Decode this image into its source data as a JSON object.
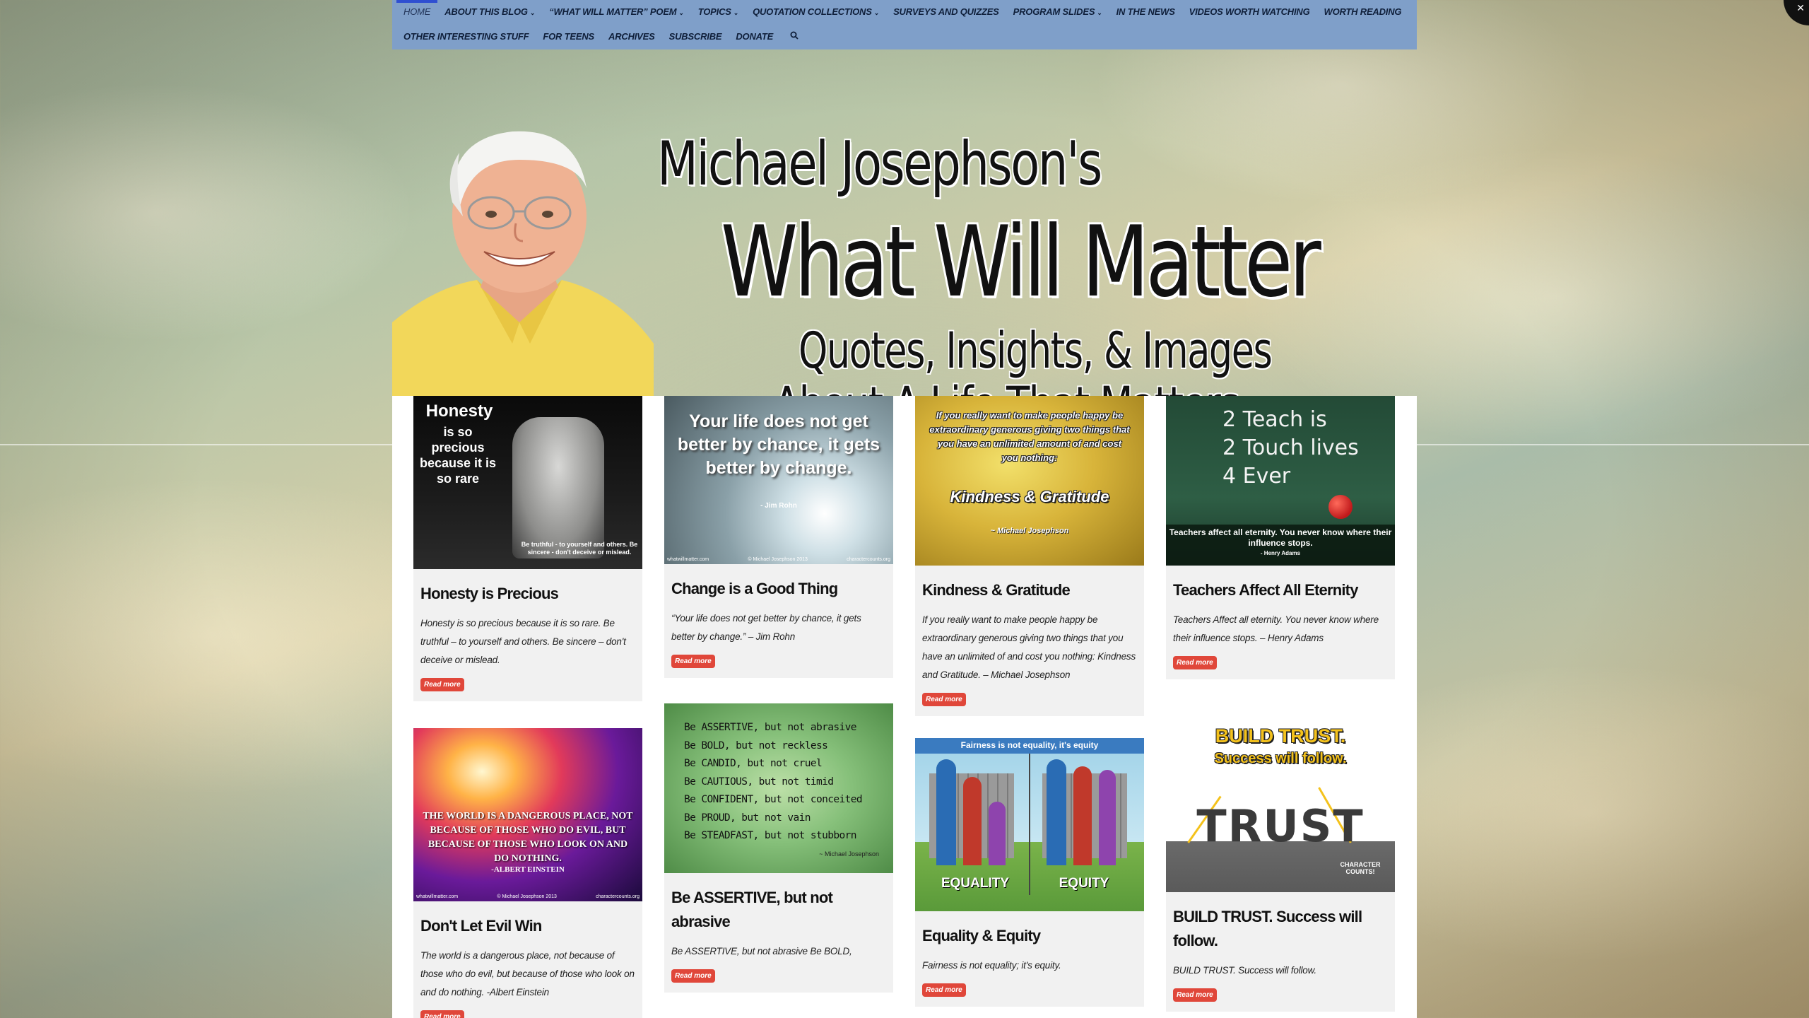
{
  "nav": {
    "row1": [
      {
        "label": "HOME",
        "chevron": false,
        "active": true
      },
      {
        "label": "ABOUT THIS BLOG",
        "chevron": true
      },
      {
        "label": "“WHAT WILL MATTER” POEM",
        "chevron": true
      },
      {
        "label": "TOPICS",
        "chevron": true
      },
      {
        "label": "QUOTATION COLLECTIONS",
        "chevron": true
      },
      {
        "label": "SURVEYS AND QUIZZES",
        "chevron": false
      },
      {
        "label": "PROGRAM SLIDES",
        "chevron": true
      },
      {
        "label": "IN THE NEWS",
        "chevron": false
      },
      {
        "label": "VIDEOS WORTH WATCHING",
        "chevron": false
      },
      {
        "label": "WORTH READING",
        "chevron": false
      }
    ],
    "row2": [
      {
        "label": "OTHER INTERESTING STUFF"
      },
      {
        "label": "FOR TEENS"
      },
      {
        "label": "ARCHIVES"
      },
      {
        "label": "SUBSCRIBE"
      },
      {
        "label": "DONATE"
      }
    ],
    "search_icon": "search-icon"
  },
  "header": {
    "line1": "Michael Josephson's",
    "line2": "What Will Matter",
    "line3": "Quotes, Insights, & Images",
    "line4": "About A Life That Matters"
  },
  "read_more_label": "Read more",
  "posts": {
    "honesty": {
      "title": "Honesty is Precious",
      "excerpt": "Honesty is so precious because it is so rare. Be truthful – to yourself and others. Be sincere – don't deceive or mislead.",
      "img_heading": "Honesty",
      "img_sub": "is so precious because it is so rare",
      "img_footer": "Be truthful - to yourself and others. Be sincere - don't deceive or mislead."
    },
    "change": {
      "title": "Change is a Good Thing",
      "excerpt": "“Your life does not get better by chance, it gets better by change.” – Jim Rohn",
      "img_text": "Your life does not get better by chance, it gets better by change.",
      "img_author": "- Jim Rohn",
      "img_site": "whatwillmatter.com",
      "img_copy": "© Michael Josephson 2013",
      "img_site2": "charactercounts.org"
    },
    "kindness": {
      "title": "Kindness & Gratitude",
      "excerpt": "If you really want to make people happy be extraordinary generous giving two things that you have an unlimited of and cost you nothing: Kindness and Gratitude. – Michael Josephson",
      "img_text": "If you really want to make people happy be extraordinary generous giving two things that you have an unlimited amount of and cost you nothing:",
      "img_heading": "Kindness & Gratitude",
      "img_author": "~ Michael Josephson"
    },
    "teachers": {
      "title": "Teachers Affect All Eternity",
      "excerpt": "Teachers Affect all eternity. You never know where their influence stops. – Henry Adams",
      "img_l1": "2 Teach is",
      "img_l2": "2 Touch lives",
      "img_l3": "4 Ever",
      "img_caption": "Teachers affect all eternity. You never know where their influence stops.",
      "img_author": "- Henry Adams"
    },
    "evil": {
      "title": "Don't Let Evil Win",
      "excerpt": "The world is a dangerous place, not because of those who do evil, but because of those who look on and do nothing. -Albert Einstein",
      "img_text": "THE WORLD IS A DANGEROUS PLACE, NOT BECAUSE OF THOSE WHO DO EVIL, BUT BECAUSE OF THOSE WHO LOOK ON AND DO NOTHING.",
      "img_author": "-ALBERT EINSTEIN",
      "img_site": "whatwillmatter.com",
      "img_copy": "© Michael Josephson 2013",
      "img_site2": "charactercounts.org"
    },
    "assertive": {
      "title": "Be ASSERTIVE, but not abrasive",
      "excerpt": "Be ASSERTIVE, but not abrasive Be BOLD,",
      "img_lines": [
        "Be ASSERTIVE, but not abrasive",
        "Be BOLD, but not reckless",
        "Be CANDID, but not cruel",
        "Be CAUTIOUS, but not timid",
        "Be CONFIDENT, but not conceited",
        "Be PROUD, but not vain",
        "Be STEADFAST, but not stubborn"
      ],
      "img_author": "~ Michael Josephson"
    },
    "equality": {
      "title": "Equality & Equity",
      "excerpt": "Fairness is not equality; it's equity.",
      "img_banner": "Fairness is not equality, it's equity",
      "img_left": "EQUALITY",
      "img_right": "EQUITY"
    },
    "trust": {
      "title": "BUILD TRUST. Success will follow.",
      "excerpt": "BUILD TRUST. Success will follow.",
      "img_l1": "BUILD TRUST.",
      "img_l2": "Success will follow.",
      "img_word": "TRUST",
      "img_badge": "CHARACTER COUNTS!"
    }
  },
  "colors": {
    "nav_bg": "#7f9fc9",
    "nav_active_bar": "#2f4fd1",
    "read_more": "#e0473a",
    "card_bg": "#f1f1f1"
  }
}
